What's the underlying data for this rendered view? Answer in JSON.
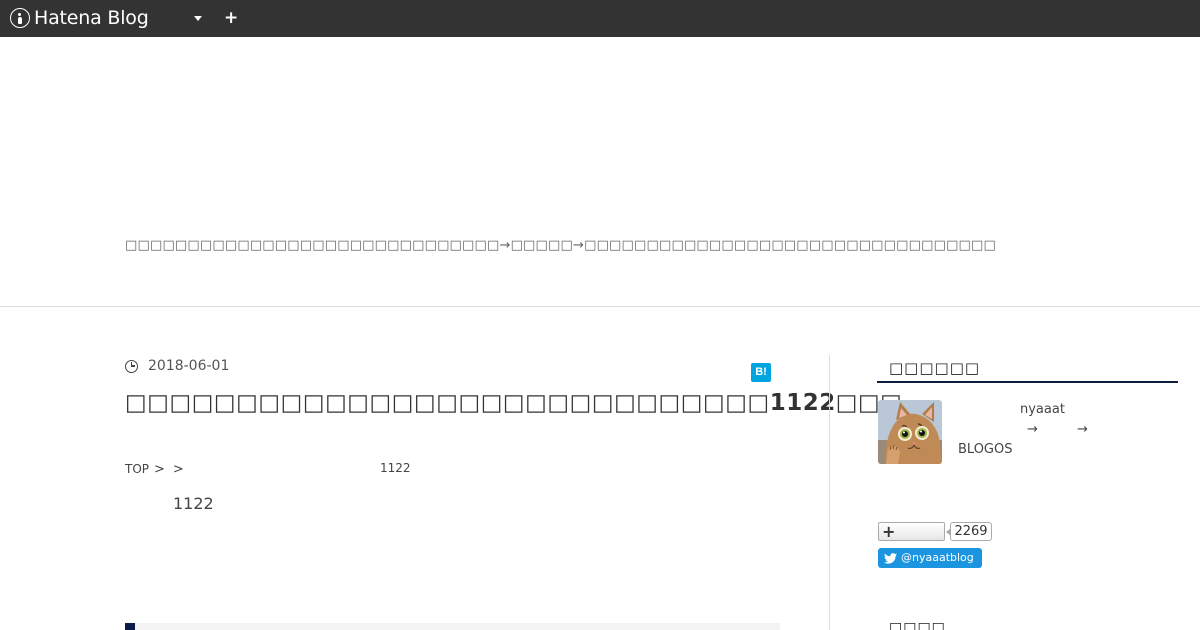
{
  "globalbar": {
    "logo_text": "Hatena Blog",
    "menu_icon": "chevron-down-icon",
    "add_icon": "plus-icon"
  },
  "blog": {
    "description": "□□□□□□□□□□□□□□□□□□□□□□□□□□□□□□→□□□□□→□□□□□□□□□□□□□□□□□□□□□□□□□□□□□□□□□"
  },
  "entry": {
    "date": "2018-06-01",
    "bookmark_label": "B!",
    "title": "□□□□□□□□□□□□□□□□□□□□□□□□□□□□□1122□□□",
    "breadcrumb": {
      "top": "TOP",
      "sep": ">",
      "number": "1122"
    },
    "body_number": "1122"
  },
  "sidebar": {
    "profile_title": "□□□□□□",
    "profile": {
      "name": "nyaaat",
      "arrow_a": "→",
      "arrow_b": "→",
      "site": "BLOGOS"
    },
    "follow_count": "2269",
    "twitter_handle": "@nyaaatblog",
    "next_module_title": "□□□□"
  },
  "colors": {
    "globalbar": "#333333",
    "accent_underline": "#0f1e3d",
    "bookmark": "#00a4de",
    "twitter": "#1b95e0"
  }
}
